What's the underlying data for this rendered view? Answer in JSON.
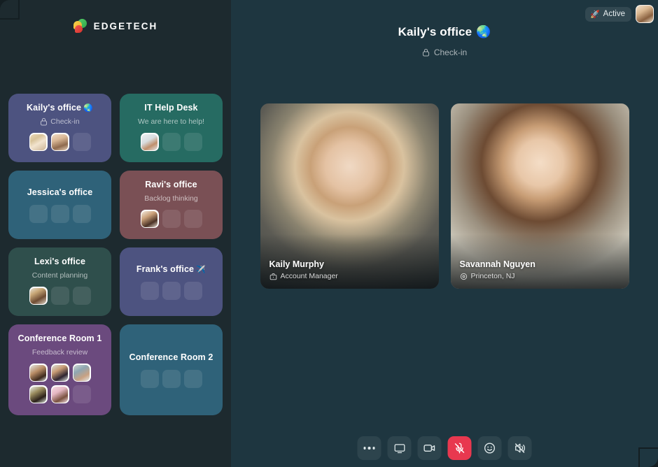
{
  "brand": {
    "name": "EDGETECH",
    "icon": "edgetech-logo"
  },
  "sidebar": {
    "rooms": [
      {
        "name": "Kaily's office",
        "emoji": "🌏",
        "status": "Check-in",
        "locked": true,
        "color": "#4d5380",
        "avatar_slots": 3,
        "members": [
          {
            "photo": "linear-gradient(150deg,#e9d8b8 0%,#d8c39a 30%,#f2e4cf 55%,#cbb495 100%)"
          },
          {
            "photo": "linear-gradient(160deg,#f0ddc6 0%,#d9b795 35%,#8f6a4e 70%,#e8d2ba 100%)"
          }
        ]
      },
      {
        "name": "IT Help Desk",
        "emoji": "",
        "status": "We are here to help!",
        "locked": false,
        "color": "#266b62",
        "avatar_slots": 3,
        "members": [
          {
            "photo": "linear-gradient(150deg,#eef0f2 0%,#d8dde0 40%,#c08f6c 68%,#e7e9ea 100%)"
          }
        ]
      },
      {
        "name": "Jessica's office",
        "emoji": "",
        "status": "",
        "locked": false,
        "color": "#2f6279",
        "avatar_slots": 3,
        "members": []
      },
      {
        "name": "Ravi's office",
        "emoji": "",
        "status": "Backlog thinking",
        "locked": false,
        "color": "#7a5055",
        "avatar_slots": 3,
        "members": [
          {
            "photo": "linear-gradient(150deg,#f4ece2 0%,#caa079 35%,#4b3226 70%,#eadfd2 100%)"
          }
        ]
      },
      {
        "name": "Lexi's office",
        "emoji": "",
        "status": "Content planning",
        "locked": false,
        "color": "#2f4f4c",
        "avatar_slots": 3,
        "members": [
          {
            "photo": "linear-gradient(150deg,#e7e1d4 0%,#c9a878 30%,#6e4c33 65%,#ded5c6 100%)"
          }
        ]
      },
      {
        "name": "Frank's office",
        "emoji": "✈️",
        "status": "",
        "locked": false,
        "color": "#4d5380",
        "avatar_slots": 3,
        "members": []
      },
      {
        "name": "Conference Room 1",
        "emoji": "",
        "status": "Feedback review",
        "locked": false,
        "color": "#6b4a7e",
        "avatar_slots": 6,
        "members": [
          {
            "photo": "linear-gradient(150deg,#e4e7e4 0%,#b98d66 40%,#3d2a1d 75%,#dfe2df 100%)"
          },
          {
            "photo": "linear-gradient(150deg,#dbe2dc 0%,#c79a74 35%,#2e2430 70%,#e2e6e1 100%)"
          },
          {
            "photo": "linear-gradient(150deg,#cfd8d2 0%,#8fa6b2 35%,#c9a283 70%,#e3e8e6 100%)"
          },
          {
            "photo": "linear-gradient(150deg,#e9eee8 0%,#9a8c5e 35%,#2b211a 70%,#d8dfd4 100%)"
          },
          {
            "photo": "linear-gradient(150deg,#f7dde4 0%,#e5b8c3 35%,#7a5240 70%,#f4dde3 100%)"
          }
        ]
      },
      {
        "name": "Conference Room 2",
        "emoji": "",
        "status": "",
        "locked": false,
        "color": "#2f6279",
        "avatar_slots": 3,
        "members": []
      }
    ]
  },
  "topbar": {
    "status_label": "Active",
    "status_emoji": "🚀",
    "me_avatar": "linear-gradient(150deg,#f1e2cd 0%,#d9b68f 35%,#8a6140 70%,#eedfc9 100%)"
  },
  "room_header": {
    "title": "Kaily's office",
    "emoji": "🌏",
    "status": "Check-in",
    "lock_icon": "lock-icon"
  },
  "stage": {
    "participants": [
      {
        "name": "Kaily Murphy",
        "meta": "Account Manager",
        "meta_icon": "briefcase-icon",
        "photo": "radial-gradient(circle at 50% 34%, #f0d9c4 0%, #e4c2a3 16%, #c9a178 26%, #d9c29f 36%, #8a836f 52%, #5c5b54 68%, #3f4442 100%)"
      },
      {
        "name": "Savannah Nguyen",
        "meta": "Princeton, NJ",
        "meta_icon": "location-icon",
        "photo": "radial-gradient(circle at 50% 32%, #f4ddc6 0%, #e8c7a8 15%, #c79c74 24%, #6d4b33 38%, #9a8f7e 56%, #c7c2b4 74%, #b7b2a4 100%)"
      }
    ]
  },
  "toolbar": {
    "buttons": [
      {
        "name": "more-options-button",
        "icon": "ellipsis-icon",
        "active": false,
        "label": "More"
      },
      {
        "name": "screen-share-button",
        "icon": "monitor-icon",
        "active": false,
        "label": "Share screen"
      },
      {
        "name": "camera-button",
        "icon": "video-camera-icon",
        "active": false,
        "label": "Camera"
      },
      {
        "name": "microphone-button",
        "icon": "microphone-muted-icon",
        "active": true,
        "label": "Microphone muted"
      },
      {
        "name": "reactions-button",
        "icon": "smiley-icon",
        "active": false,
        "label": "Reactions"
      },
      {
        "name": "speaker-button",
        "icon": "speaker-muted-icon",
        "active": false,
        "label": "Speaker"
      }
    ]
  },
  "colors": {
    "app_background": "#141e22",
    "sidebar_background": "#1d2a2f",
    "main_background": "#1e3640",
    "danger": "#e8384f"
  }
}
